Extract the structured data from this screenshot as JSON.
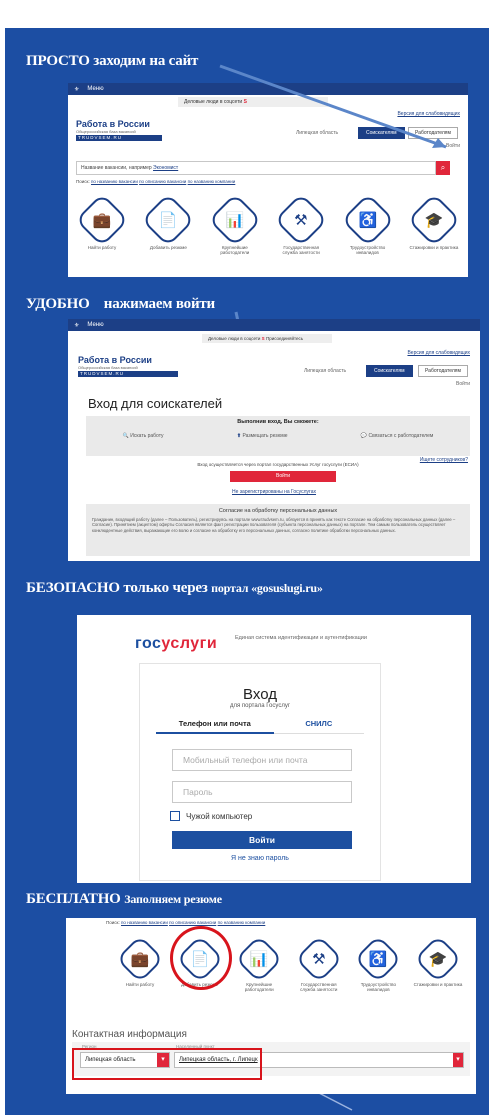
{
  "headings": {
    "h1": "ПРОСТО заходим на сайт",
    "h2_a": "УДОБНО",
    "h2_b": "нажимаем войти",
    "h3_a": "БЕЗОПАСНО только через ",
    "h3_b": "портал «gosuslugi.ru»",
    "h4_a": "БЕСПЛАТНО ",
    "h4_b": "Заполняем резюме"
  },
  "site": {
    "menu": "Меню",
    "top_banner": "Деловые люди в соцсети",
    "top_banner_2": "Присоединяйтесь",
    "logo": "Работа в России",
    "logo_sub": "Общероссийская база вакансий",
    "logo_bar": "TRUDVSEM.RU",
    "employer_version": "Версия для слабовидящих",
    "region": "Липецкая область",
    "tab_seekers": "Соискателям",
    "tab_employers": "Работодателям",
    "login": "Войти",
    "search_placeholder": "Название вакансии, например",
    "search_example": "Экономист",
    "search_scope": "Поиск:",
    "scope_1": "по названию вакансии",
    "scope_2": "по описанию вакансии",
    "scope_3": "по названию компании"
  },
  "services": [
    {
      "icon": "briefcase-icon",
      "glyph": "💼",
      "label": "Найти работу"
    },
    {
      "icon": "resume-icon",
      "glyph": "📄",
      "label": "Добавить резюме"
    },
    {
      "icon": "chart-icon",
      "glyph": "📊",
      "label": "Крупнейшие работодатели"
    },
    {
      "icon": "tools-icon",
      "glyph": "⚒",
      "label": "Государственная служба занятости"
    },
    {
      "icon": "wheelchair-icon",
      "glyph": "♿",
      "label": "Трудоустройство инвалидов"
    },
    {
      "icon": "graduation-icon",
      "glyph": "🎓",
      "label": "Стажировки и практика"
    }
  ],
  "login_page": {
    "title": "Вход для соискателей",
    "can_title": "Выполнив вход, Вы сможете:",
    "can_1": "Искать работу",
    "can_2": "Размещать резюме",
    "can_3": "Связаться с работодателем",
    "employer_q": "Ищете сотрудников?",
    "esia_text": "Вход осуществляется через портал государственных Услуг госуслуги (ЕСИА)",
    "login_btn": "Войти",
    "not_registered": "Не зарегистрированы на Госуслугах",
    "consent_title": "Согласие на обработку персональных данных",
    "consent_text": "Гражданин, входящий работу (далее – Пользователь), регистрируясь на портале www.trudvsem.ru, обязуется в принять как тексте Согласие на обработку персональных данных (далее – Согласие). Принятием (акцептом) оферты Согласия является факт регистрации пользователя (субъекта персональных данных) на портале. Тем самым пользователь осуществляет конклюдентные действия, выражающие его волю и согласие на обработку его персональных данных, согласно политике обработки персональных данных."
  },
  "gosuslugi": {
    "logo_gos": "гос",
    "logo_uslugi": "услуги",
    "logo_sub": "Единая система идентификации и аутентификации",
    "title": "Вход",
    "subtitle": "для портала Госуслуг",
    "tab_phone": "Телефон или почта",
    "tab_snils": "СНИЛС",
    "phone_placeholder": "Мобильный телефон или почта",
    "password_placeholder": "Пароль",
    "foreign_pc": "Чужой компьютер",
    "login_btn": "Войти",
    "forgot": "Я не знаю пароль"
  },
  "resume": {
    "contact_title": "Контактная информация",
    "region_label": "Регион",
    "region_value": "Липецкая область",
    "locality_label": "Населенный пункт",
    "locality_value": "Липецкая область, г. Липецк"
  },
  "colors": {
    "background": "#1c4ea3",
    "brand_blue": "#1c3f86",
    "brand_red": "#e0263a",
    "highlight": "#d8141c"
  }
}
